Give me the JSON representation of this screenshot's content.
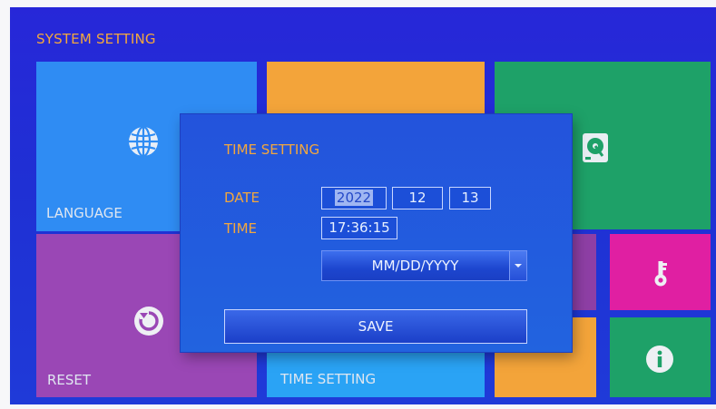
{
  "header": {
    "title": "SYSTEM SETTING"
  },
  "tiles": {
    "language": {
      "label": "LANGUAGE",
      "icon": "globe-icon"
    },
    "reset": {
      "label": "RESET",
      "icon": "reset-icon"
    },
    "time_setting": {
      "label": "TIME SETTING"
    },
    "storage": {
      "icon": "hard-disk-icon"
    },
    "password": {
      "icon": "key-icon"
    },
    "info": {
      "icon": "info-icon"
    }
  },
  "dialog": {
    "title": "TIME SETTING",
    "date_label": "DATE",
    "time_label": "TIME",
    "date": {
      "year": "2022",
      "month": "12",
      "day": "13"
    },
    "time_value": "17:36:15",
    "date_format": "MM/DD/YYYY",
    "save_label": "SAVE"
  },
  "colors": {
    "background": "#2727d8",
    "accent_text": "#f2a73e",
    "tile_blue": "#2f8cf3",
    "tile_orange": "#f3a43a",
    "tile_green": "#1ea168",
    "tile_purple": "#9a47b5",
    "tile_light_blue": "#2aa3f5",
    "tile_magenta": "#e01fa2",
    "dialog": "#2353dc"
  }
}
